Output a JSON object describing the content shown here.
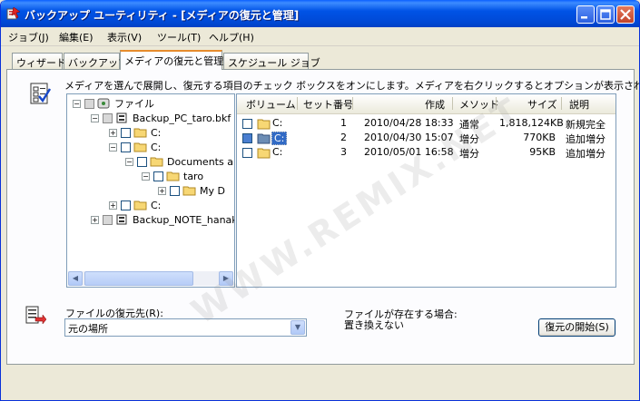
{
  "window": {
    "title": "バックアップ ユーティリティ - [メディアの復元と管理]"
  },
  "menu": [
    {
      "label": "ジョブ(J)"
    },
    {
      "label": "編集(E)"
    },
    {
      "label": "表示(V)"
    },
    {
      "label": "ツール(T)"
    },
    {
      "label": "ヘルプ(H)"
    }
  ],
  "tabs": [
    {
      "label": "ウィザード"
    },
    {
      "label": "バックアップ"
    },
    {
      "label": "メディアの復元と管理"
    },
    {
      "label": "スケジュール ジョブ"
    }
  ],
  "hint": "メディアを選んで展開し、復元する項目のチェック ボックスをオンにします。メディアを右クリックするとオプションが表示されます(C):",
  "tree": [
    {
      "label": "ファイル"
    },
    {
      "label": "Backup_PC_taro.bkf"
    },
    {
      "label": "C:"
    },
    {
      "label": "C:"
    },
    {
      "label": "Documents a"
    },
    {
      "label": "taro"
    },
    {
      "label": "My D"
    },
    {
      "label": "C:"
    },
    {
      "label": "Backup_NOTE_hanak"
    }
  ],
  "list": {
    "headers": [
      "ボリューム",
      "セット番号",
      "作成",
      "メソッド",
      "サイズ",
      "説明"
    ],
    "rows": [
      {
        "volume": "C:",
        "set": "1",
        "created": "2010/04/28 18:33",
        "method": "通常",
        "size": "1,818,124KB",
        "desc": "新規完全",
        "selected": false
      },
      {
        "volume": "C:",
        "set": "2",
        "created": "2010/04/30 15:07",
        "method": "増分",
        "size": "770KB",
        "desc": "追加増分",
        "selected": true
      },
      {
        "volume": "C:",
        "set": "3",
        "created": "2010/05/01 16:58",
        "method": "増分",
        "size": "95KB",
        "desc": "追加増分",
        "selected": false
      }
    ]
  },
  "restore": {
    "dest_label": "ファイルの復元先(R):",
    "dest_value": "元の場所",
    "exist_label": "ファイルが存在する場合:",
    "exist_value": "置き換えない",
    "start_button": "復元の開始(S)"
  },
  "watermark": "WWW.REMIX.NET",
  "colors": {
    "titlebar": "#0053e6",
    "selection": "#316ac5",
    "tab_highlight": "#e68b2c"
  }
}
